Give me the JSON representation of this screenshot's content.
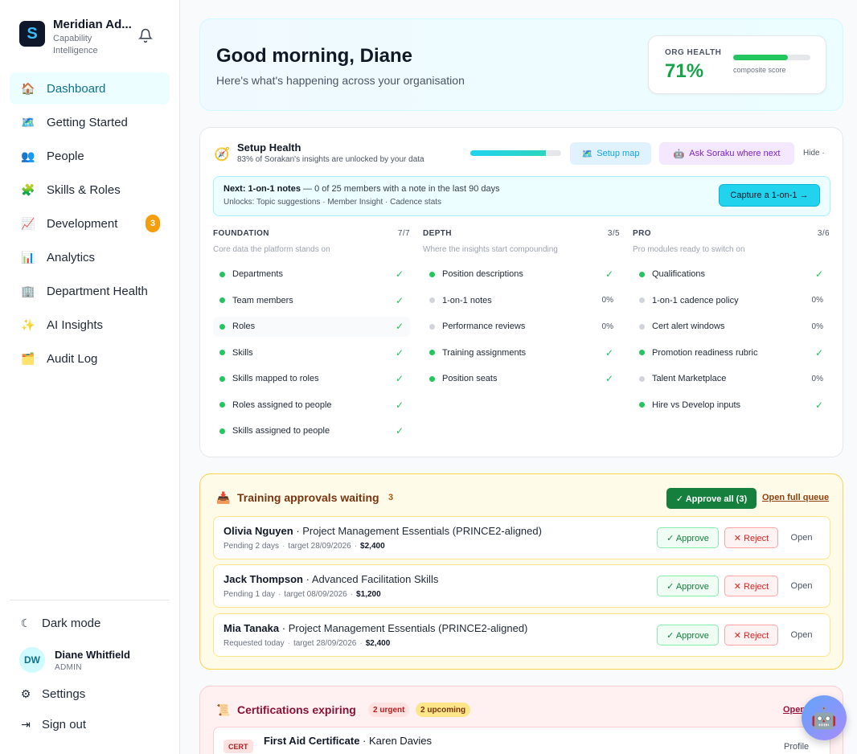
{
  "brand": {
    "name": "Meridian Ad...",
    "subtitle": "Capability Intelligence",
    "logo_letter": "S"
  },
  "nav": [
    {
      "label": "Dashboard",
      "icon": "house-icon",
      "active": true
    },
    {
      "label": "Getting Started",
      "icon": "map-icon"
    },
    {
      "label": "People",
      "icon": "people-icon"
    },
    {
      "label": "Skills & Roles",
      "icon": "puzzle-icon"
    },
    {
      "label": "Development",
      "icon": "chart-up-icon",
      "badge": "3"
    },
    {
      "label": "Analytics",
      "icon": "bar-chart-icon"
    },
    {
      "label": "Department Health",
      "icon": "building-icon"
    },
    {
      "label": "AI Insights",
      "icon": "sparkles-icon"
    },
    {
      "label": "Audit Log",
      "icon": "folder-icon"
    }
  ],
  "sidebar_bottom": {
    "dark_mode": "Dark mode",
    "user_initials": "DW",
    "user_name": "Diane Whitfield",
    "user_role": "ADMIN",
    "settings": "Settings",
    "sign_out": "Sign out"
  },
  "hero": {
    "title": "Good morning, Diane",
    "subtitle": "Here's what's happening across your organisation",
    "health_label": "ORG HEALTH",
    "health_value": "71%",
    "health_fraction": 0.71,
    "health_caption": "composite score"
  },
  "setup": {
    "title": "Setup Health",
    "subtitle": "83% of Sorakan's insights are unlocked by your data",
    "progress": 0.83,
    "map_button": "Setup map",
    "ask_button": "Ask Soraku where next",
    "hide": "Hide",
    "next_label": "Next: 1-on-1 notes",
    "next_text": " — 0 of 25 members with a note in the last 90 days",
    "unlocks": "Unlocks: Topic suggestions · Member Insight · Cadence stats",
    "capture_button": "Capture a 1-on-1 →",
    "columns": [
      {
        "title": "FOUNDATION",
        "count": "7/7",
        "subtitle": "Core data the platform stands on",
        "items": [
          {
            "label": "Departments",
            "done": true,
            "status": "✓"
          },
          {
            "label": "Team members",
            "done": true,
            "status": "✓"
          },
          {
            "label": "Roles",
            "done": true,
            "status": "✓"
          },
          {
            "label": "Skills",
            "done": true,
            "status": "✓"
          },
          {
            "label": "Skills mapped to roles",
            "done": true,
            "status": "✓"
          },
          {
            "label": "Roles assigned to people",
            "done": true,
            "status": "✓"
          },
          {
            "label": "Skills assigned to people",
            "done": true,
            "status": "✓"
          }
        ]
      },
      {
        "title": "DEPTH",
        "count": "3/5",
        "subtitle": "Where the insights start compounding",
        "items": [
          {
            "label": "Position descriptions",
            "done": true,
            "status": "✓"
          },
          {
            "label": "1-on-1 notes",
            "done": false,
            "status": "0%"
          },
          {
            "label": "Performance reviews",
            "done": false,
            "status": "0%"
          },
          {
            "label": "Training assignments",
            "done": true,
            "status": "✓"
          },
          {
            "label": "Position seats",
            "done": true,
            "status": "✓"
          }
        ]
      },
      {
        "title": "PRO",
        "count": "3/6",
        "subtitle": "Pro modules ready to switch on",
        "items": [
          {
            "label": "Qualifications",
            "done": true,
            "status": "✓"
          },
          {
            "label": "1-on-1 cadence policy",
            "done": false,
            "status": "0%"
          },
          {
            "label": "Cert alert windows",
            "done": false,
            "status": "0%"
          },
          {
            "label": "Promotion readiness rubric",
            "done": true,
            "status": "✓"
          },
          {
            "label": "Talent Marketplace",
            "done": false,
            "status": "0%"
          },
          {
            "label": "Hire vs Develop inputs",
            "done": true,
            "status": "✓"
          }
        ]
      }
    ]
  },
  "training": {
    "title": "Training approvals waiting",
    "count": "3",
    "approve_all": "✓ Approve all (3)",
    "queue_link": "Open full queue",
    "approve": "✓ Approve",
    "reject": "✕ Reject",
    "open": "Open",
    "requests": [
      {
        "name": "Olivia Nguyen",
        "course": "Project Management Essentials (PRINCE2-aligned)",
        "status": "Pending 2 days",
        "target": "target 28/09/2026",
        "amount": "$2,400"
      },
      {
        "name": "Jack Thompson",
        "course": "Advanced Facilitation Skills",
        "status": "Pending 1 day",
        "target": "target 08/09/2026",
        "amount": "$1,200"
      },
      {
        "name": "Mia Tanaka",
        "course": "Project Management Essentials (PRINCE2-aligned)",
        "status": "Requested today",
        "target": "target 28/09/2026",
        "amount": "$2,400"
      }
    ]
  },
  "certs": {
    "title": "Certifications expiring",
    "urgent": "2 urgent",
    "upcoming": "2 upcoming",
    "link": "Open",
    "row": {
      "tag": "CERT",
      "name": "First Aid Certificate",
      "person": "Karen Davies",
      "action": "Profile"
    }
  }
}
